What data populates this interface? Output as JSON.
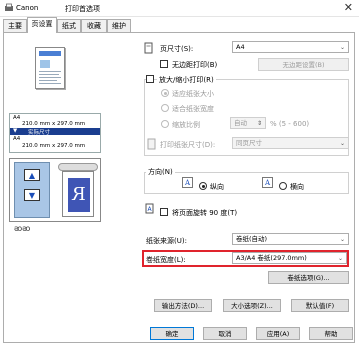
{
  "window": {
    "brand": "Canon",
    "title": "打印首选项",
    "close_glyph": "✕"
  },
  "tabs": [
    "主要",
    "页设置",
    "纸式",
    "收藏",
    "维护"
  ],
  "preview_info": {
    "line1": "A4",
    "line2": "210.0 mm x 297.0 mm",
    "line3": "实际尺寸",
    "line4": "A4",
    "line5": "210.0 mm x 297.0 mm"
  },
  "page_size": {
    "label": "页尺寸(S):",
    "value": "A4"
  },
  "borderless": {
    "label": "无边距打印(B)",
    "settings_button": "无边距设置(B)"
  },
  "scale": {
    "label": "放大/缩小打印(R)",
    "fit_page": "适应纸张大小",
    "fit_width": "适合纸张宽度",
    "ratio": "缩放比例",
    "ratio_value": "自动",
    "ratio_range": "% (5 - 600)",
    "print_size_label": "打印纸张尺寸(D):",
    "print_size_value": "同页尺寸"
  },
  "orientation": {
    "label": "方向(N)",
    "portrait": "纵向",
    "landscape": "横向",
    "rotate_label": "将页面旋转 90 度(T)"
  },
  "paper_source": {
    "label": "纸张来源(U):",
    "value": "卷纸(自动)"
  },
  "roll_width": {
    "label": "卷纸宽度(L):",
    "value": "A3/A4 卷纸(297.0mm)"
  },
  "buttons": {
    "roll_options": "卷纸选项(G)...",
    "output_method": "输出方法(D)...",
    "size_options": "大小选项(Z)...",
    "defaults": "默认值(F)",
    "ok": "确定",
    "cancel": "取消",
    "apply": "应用(A)",
    "help": "帮助"
  },
  "colors": {
    "highlight_border": "#e0242d",
    "selection_bg": "#1a3d8f"
  }
}
